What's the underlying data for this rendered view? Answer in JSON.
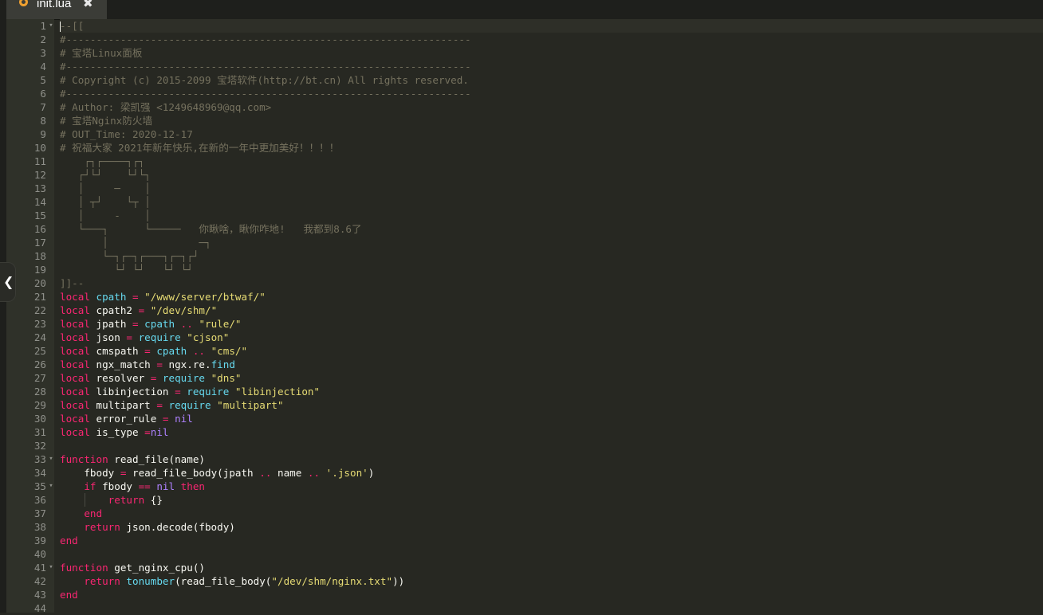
{
  "tab": {
    "label": "init.lua",
    "close": "✖",
    "icon": "lua-file-icon"
  },
  "colors": {
    "background": "#272822",
    "gutter": "#2f3129",
    "comment": "#75715e",
    "keyword": "#f92672",
    "string": "#e6db74",
    "variable": "#66d9ef",
    "constant": "#ae81ff",
    "text": "#f8f8f2"
  },
  "lines": [
    {
      "n": "1",
      "fold": "▾",
      "tokens": [
        [
          "comment",
          "--[["
        ]
      ]
    },
    {
      "n": "2",
      "tokens": [
        [
          "comment",
          "#-------------------------------------------------------------------"
        ]
      ]
    },
    {
      "n": "3",
      "tokens": [
        [
          "comment",
          "# 宝塔Linux面板"
        ]
      ]
    },
    {
      "n": "4",
      "tokens": [
        [
          "comment",
          "#-------------------------------------------------------------------"
        ]
      ]
    },
    {
      "n": "5",
      "tokens": [
        [
          "comment",
          "# Copyright (c) 2015-2099 宝塔软件(http://bt.cn) All rights reserved."
        ]
      ]
    },
    {
      "n": "6",
      "tokens": [
        [
          "comment",
          "#-------------------------------------------------------------------"
        ]
      ]
    },
    {
      "n": "7",
      "tokens": [
        [
          "comment",
          "# Author: 梁凯强 <1249648969@qq.com>"
        ]
      ]
    },
    {
      "n": "8",
      "tokens": [
        [
          "comment",
          "# 宝塔Nginx防火墙"
        ]
      ]
    },
    {
      "n": "9",
      "tokens": [
        [
          "comment",
          "# OUT_Time: 2020-12-17"
        ]
      ]
    },
    {
      "n": "10",
      "tokens": [
        [
          "comment",
          "# 祝福大家 2021年新年快乐,在新的一年中更加美好！！！！"
        ]
      ]
    },
    {
      "n": "11",
      "tokens": [
        [
          "comment",
          "    ┌┐┌────┐┌┐"
        ]
      ]
    },
    {
      "n": "12",
      "tokens": [
        [
          "comment",
          "   ┌┘└┘    └┘└┐"
        ]
      ]
    },
    {
      "n": "13",
      "tokens": [
        [
          "comment",
          "   │     ─    │"
        ]
      ]
    },
    {
      "n": "14",
      "tokens": [
        [
          "comment",
          "   │ ┬┘    └┬ │"
        ]
      ]
    },
    {
      "n": "15",
      "tokens": [
        [
          "comment",
          "   │     -    │"
        ]
      ]
    },
    {
      "n": "16",
      "tokens": [
        [
          "comment",
          "   └───┐      └─────   你瞅啥，瞅你咋地!   我都到8.6了"
        ]
      ]
    },
    {
      "n": "17",
      "tokens": [
        [
          "comment",
          "       │               ─┐"
        ]
      ]
    },
    {
      "n": "18",
      "tokens": [
        [
          "comment",
          "       └─┐┌─┐┌───┐┌─┐┌┘"
        ]
      ]
    },
    {
      "n": "19",
      "tokens": [
        [
          "comment",
          "         └┘ └┘   └┘ └┘"
        ]
      ]
    },
    {
      "n": "20",
      "tokens": [
        [
          "comment",
          "]]--"
        ]
      ]
    },
    {
      "n": "21",
      "tokens": [
        [
          "kw",
          "local "
        ],
        [
          "var",
          "cpath"
        ],
        [
          "op",
          " = "
        ],
        [
          "str",
          "\"/www/server/btwaf/\""
        ]
      ]
    },
    {
      "n": "22",
      "tokens": [
        [
          "kw",
          "local "
        ],
        [
          "id",
          "cpath2"
        ],
        [
          "op",
          " = "
        ],
        [
          "str",
          "\"/dev/shm/\""
        ]
      ]
    },
    {
      "n": "23",
      "tokens": [
        [
          "kw",
          "local "
        ],
        [
          "id",
          "jpath"
        ],
        [
          "op",
          " = "
        ],
        [
          "var",
          "cpath"
        ],
        [
          "op",
          " .. "
        ],
        [
          "str",
          "\"rule/\""
        ]
      ]
    },
    {
      "n": "24",
      "tokens": [
        [
          "kw",
          "local "
        ],
        [
          "id",
          "json"
        ],
        [
          "op",
          " = "
        ],
        [
          "builtin",
          "require "
        ],
        [
          "str",
          "\"cjson\""
        ]
      ]
    },
    {
      "n": "25",
      "tokens": [
        [
          "kw",
          "local "
        ],
        [
          "id",
          "cmspath"
        ],
        [
          "op",
          " = "
        ],
        [
          "var",
          "cpath"
        ],
        [
          "op",
          " .. "
        ],
        [
          "str",
          "\"cms/\""
        ]
      ]
    },
    {
      "n": "26",
      "tokens": [
        [
          "kw",
          "local "
        ],
        [
          "id",
          "ngx_match"
        ],
        [
          "op",
          " = "
        ],
        [
          "id",
          "ngx.re."
        ],
        [
          "builtin",
          "find"
        ]
      ]
    },
    {
      "n": "27",
      "tokens": [
        [
          "kw",
          "local "
        ],
        [
          "id",
          "resolver"
        ],
        [
          "op",
          " = "
        ],
        [
          "builtin",
          "require "
        ],
        [
          "str",
          "\"dns\""
        ]
      ]
    },
    {
      "n": "28",
      "tokens": [
        [
          "kw",
          "local "
        ],
        [
          "id",
          "libinjection"
        ],
        [
          "op",
          " = "
        ],
        [
          "builtin",
          "require "
        ],
        [
          "str",
          "\"libinjection\""
        ]
      ]
    },
    {
      "n": "29",
      "tokens": [
        [
          "kw",
          "local "
        ],
        [
          "id",
          "multipart"
        ],
        [
          "op",
          " = "
        ],
        [
          "builtin",
          "require "
        ],
        [
          "str",
          "\"multipart\""
        ]
      ]
    },
    {
      "n": "30",
      "tokens": [
        [
          "kw",
          "local "
        ],
        [
          "id",
          "error_rule"
        ],
        [
          "op",
          " = "
        ],
        [
          "const",
          "nil"
        ]
      ]
    },
    {
      "n": "31",
      "tokens": [
        [
          "kw",
          "local "
        ],
        [
          "id",
          "is_type "
        ],
        [
          "op",
          "="
        ],
        [
          "const",
          "nil"
        ]
      ]
    },
    {
      "n": "32",
      "tokens": []
    },
    {
      "n": "33",
      "fold": "▾",
      "tokens": [
        [
          "kw",
          "function "
        ],
        [
          "fn",
          "read_file(name)"
        ]
      ]
    },
    {
      "n": "34",
      "tokens": [
        [
          "id",
          "    fbody "
        ],
        [
          "op",
          "= "
        ],
        [
          "fn",
          "read_file_body(jpath "
        ],
        [
          "op",
          ".. "
        ],
        [
          "id",
          "name "
        ],
        [
          "op",
          ".. "
        ],
        [
          "str",
          "'.json'"
        ],
        [
          "id",
          ")"
        ]
      ]
    },
    {
      "n": "35",
      "fold": "▾",
      "tokens": [
        [
          "kw",
          "    if "
        ],
        [
          "id",
          "fbody "
        ],
        [
          "op",
          "== "
        ],
        [
          "const",
          "nil "
        ],
        [
          "kw",
          "then"
        ]
      ]
    },
    {
      "n": "36",
      "guide": true,
      "tokens": [
        [
          "kw",
          "        return "
        ],
        [
          "id",
          "{}"
        ]
      ]
    },
    {
      "n": "37",
      "tokens": [
        [
          "kw",
          "    end"
        ]
      ]
    },
    {
      "n": "38",
      "tokens": [
        [
          "kw",
          "    return "
        ],
        [
          "fn",
          "json.decode(fbody)"
        ]
      ]
    },
    {
      "n": "39",
      "tokens": [
        [
          "kw",
          "end"
        ]
      ]
    },
    {
      "n": "40",
      "tokens": []
    },
    {
      "n": "41",
      "fold": "▾",
      "tokens": [
        [
          "kw",
          "function "
        ],
        [
          "fn",
          "get_nginx_cpu()"
        ]
      ]
    },
    {
      "n": "42",
      "tokens": [
        [
          "kw",
          "    return "
        ],
        [
          "builtin",
          "tonumber"
        ],
        [
          "id",
          "(read_file_body("
        ],
        [
          "str",
          "\"/dev/shm/nginx.txt\""
        ],
        [
          "id",
          "))"
        ]
      ]
    },
    {
      "n": "43",
      "tokens": [
        [
          "kw",
          "end"
        ]
      ]
    },
    {
      "n": "44",
      "tokens": []
    }
  ]
}
